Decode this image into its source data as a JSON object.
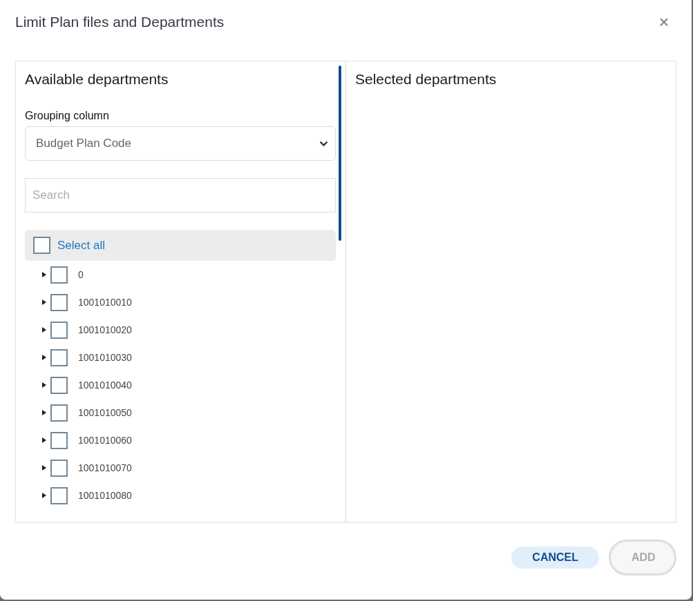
{
  "dialog": {
    "title": "Limit Plan files and Departments"
  },
  "available": {
    "heading": "Available departments",
    "grouping_label": "Grouping column",
    "grouping_value": "Budget Plan Code",
    "search": {
      "placeholder": "Search"
    },
    "select_all": {
      "label": "Select all",
      "checked": false
    },
    "items": [
      {
        "label": "0",
        "checked": false,
        "expanded": false
      },
      {
        "label": "1001010010",
        "checked": false,
        "expanded": false
      },
      {
        "label": "1001010020",
        "checked": false,
        "expanded": false
      },
      {
        "label": "1001010030",
        "checked": false,
        "expanded": false
      },
      {
        "label": "1001010040",
        "checked": false,
        "expanded": false
      },
      {
        "label": "1001010050",
        "checked": false,
        "expanded": false
      },
      {
        "label": "1001010060",
        "checked": false,
        "expanded": false
      },
      {
        "label": "1001010070",
        "checked": false,
        "expanded": false
      },
      {
        "label": "1001010080",
        "checked": false,
        "expanded": false
      }
    ]
  },
  "selected": {
    "heading": "Selected departments"
  },
  "buttons": [
    {
      "label": "CANCEL",
      "kind": "secondary",
      "disabled": false
    },
    {
      "label": "ADD",
      "kind": "primary",
      "disabled": true
    }
  ]
}
